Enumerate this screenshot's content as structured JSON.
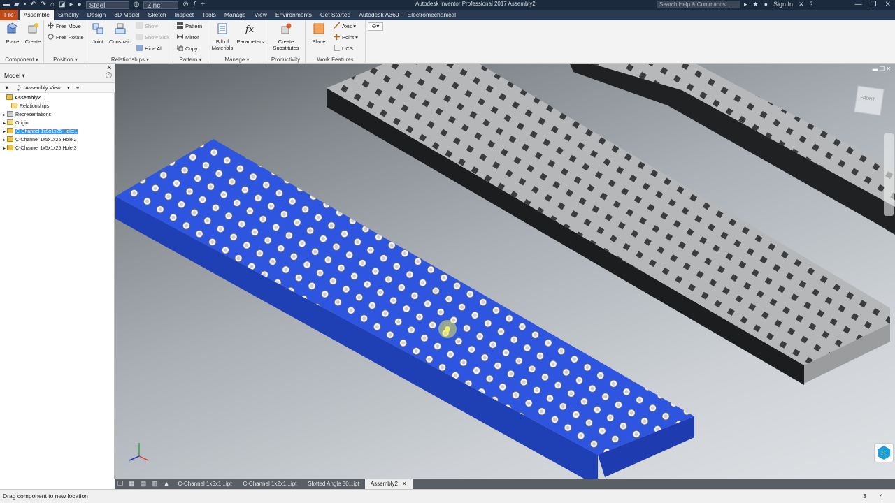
{
  "titlebar": {
    "material": "Steel",
    "appearance": "Zinc",
    "title": "Autodesk Inventor Professional 2017   Assembly2",
    "search_placeholder": "Search Help & Commands...",
    "sign_in": "Sign In"
  },
  "menu": {
    "tabs": [
      {
        "label": "File"
      },
      {
        "label": "Assemble"
      },
      {
        "label": "Simplify"
      },
      {
        "label": "Design"
      },
      {
        "label": "3D Model"
      },
      {
        "label": "Sketch"
      },
      {
        "label": "Inspect"
      },
      {
        "label": "Tools"
      },
      {
        "label": "Manage"
      },
      {
        "label": "View"
      },
      {
        "label": "Environments"
      },
      {
        "label": "Get Started"
      },
      {
        "label": "Autodesk A360"
      },
      {
        "label": "Electromechanical"
      }
    ]
  },
  "ribbon": {
    "component": {
      "title": "Component ▾",
      "place": "Place",
      "create": "Create"
    },
    "position": {
      "title": "Position ▾",
      "free_move": "Free Move",
      "free_rotate": "Free Rotate"
    },
    "relationships": {
      "title": "Relationships ▾",
      "joint": "Joint",
      "constrain": "Constrain",
      "show": "Show",
      "show_sick": "Show Sick",
      "hide_all": "Hide All"
    },
    "pattern": {
      "title": "Pattern ▾",
      "pattern": "Pattern",
      "mirror": "Mirror",
      "copy": "Copy"
    },
    "manage": {
      "title": "Manage ▾",
      "bom": "Bill of Materials",
      "parameters": "Parameters"
    },
    "productivity": {
      "title": "Productivity",
      "create_substitutes": "Create Substitutes"
    },
    "work_features": {
      "title": "Work Features",
      "plane": "Plane",
      "axis": "Axis ▾",
      "point": "Point ▾",
      "ucs": "UCS"
    }
  },
  "browser": {
    "title": "Model ▾",
    "view": "Assembly View",
    "tree": [
      {
        "label": "Assembly2"
      },
      {
        "label": "Relationships"
      },
      {
        "label": "Representations"
      },
      {
        "label": "Origin"
      },
      {
        "label": "C-Channel 1x5x1x25 Hole:1"
      },
      {
        "label": "C-Channel 1x5x1x25 Hole:2"
      },
      {
        "label": "C-Channel 1x5x1x25 Hole:3"
      }
    ]
  },
  "viewcube": {
    "face": "FRONT"
  },
  "doc_tabs": [
    {
      "label": "C-Channel 1x5x1...ipt"
    },
    {
      "label": "C-Channel 1x2x1...ipt"
    },
    {
      "label": "Slotted Angle 30...ipt"
    },
    {
      "label": "Assembly2"
    }
  ],
  "status": {
    "message": "Drag component to new location",
    "count_a": "3",
    "count_b": "4"
  },
  "colors": {
    "selection_blue": "#2d55e0",
    "part_gray": "#b4b6b8",
    "file_tab": "#c24b1b",
    "titlebar": "#1b2a3d"
  }
}
